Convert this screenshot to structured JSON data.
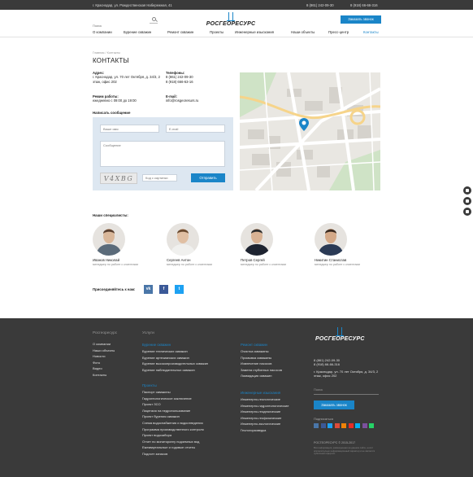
{
  "topbar": {
    "address": "г. Краснодар, ул. Рождественская Набережная, 41",
    "phone1": "8 (861) 242-09-30",
    "phone2": "8 (918) 66-66-316"
  },
  "header": {
    "search_placeholder": "Поиск",
    "logo_text": "РОСГЕОРЕСУРС",
    "call_button": "Заказать звонок"
  },
  "nav": [
    {
      "label": "О компании"
    },
    {
      "label": "Бурение скважин"
    },
    {
      "label": "Ремонт скважин"
    },
    {
      "label": "Проекты"
    },
    {
      "label": "Инженерные изыскания"
    },
    {
      "label": "Наши объекты"
    },
    {
      "label": "Пресс-центр"
    },
    {
      "label": "Контакты",
      "active": true
    }
  ],
  "breadcrumb": "Главная  /  Контакты",
  "page_title": "КОНТАКТЫ",
  "contacts": {
    "address_label": "Адрес:",
    "address_value": "г. Краснодар, ул. 70 лет Октября, д. 34/3, 2 этаж, офис 202",
    "phones_label": "Телефоны:",
    "phone1": "8 (861) 242-09-30",
    "phone2": "8 (918) 666-63-16",
    "hours_label": "Режим работы:",
    "hours_value": "ежедневно с 09:00 до 19:00",
    "email_label": "E-mail:",
    "email_value": "info@rosgeoresurs.ru"
  },
  "form": {
    "title": "Написать сообщение",
    "name_placeholder": "Ваше имя",
    "email_placeholder": "E-mail",
    "message_placeholder": "Сообщение",
    "captcha_text": "V4XBG",
    "captcha_placeholder": "Код с картинки",
    "send_button": "Отправить"
  },
  "specialists": {
    "title": "Наши специалисты:",
    "people": [
      {
        "name": "Иванов Николай",
        "position": "менеджер по работе с клиентами",
        "shirt": "#5b6b7a",
        "skin": "#d9b79a",
        "hair": "#5a4030"
      },
      {
        "name": "Сергеев Антон",
        "position": "менеджер по работе с клиентами",
        "shirt": "#f0f0ee",
        "skin": "#e0bfa3",
        "hair": "#6a4a30"
      },
      {
        "name": "Петров Сергей",
        "position": "менеджер по работе с клиентами",
        "shirt": "#1d2330",
        "skin": "#d8b294",
        "hair": "#2d2d2d"
      },
      {
        "name": "Никитин Станислав",
        "position": "менеджер по работе с клиентами",
        "shirt": "#2a3a55",
        "skin": "#d4a988",
        "hair": "#3a2a20"
      }
    ]
  },
  "join": {
    "label": "Присоединяйтесь к нам:",
    "networks": [
      {
        "icon": "vk-icon",
        "glyph": "vk",
        "color": "#4a76a8"
      },
      {
        "icon": "facebook-icon",
        "glyph": "f",
        "color": "#3b5998"
      },
      {
        "icon": "twitter-icon",
        "glyph": "t",
        "color": "#1da1f2"
      }
    ]
  },
  "footer": {
    "company_heading": "Росгеоресурс",
    "services_heading": "Услуги",
    "company_links": [
      "О компании",
      "Наши объекты",
      "Новости",
      "Фото",
      "Видео",
      "Контакты"
    ],
    "drilling": {
      "title": "Бурение скважин",
      "items": [
        "Бурение технических скважин",
        "Бурение артезианских скважин",
        "Бурение высокопроизводительных скважин",
        "Бурение наблюдательных скважин"
      ]
    },
    "repair": {
      "title": "Ремонт скважин",
      "items": [
        "Очистка скважины",
        "Промывка скважины",
        "Извлечение насосов",
        "Замена глубинных насосов",
        "Ликвидация скважин"
      ]
    },
    "projects": {
      "title": "Проекты",
      "items": [
        "Паспорт скважины",
        "Гидрогеологическое заключение",
        "Проект ЗСО",
        "Лицензия на недропользование",
        "Проект бурения скважин",
        "Схема водоснабжения и водоотведения",
        "Программа производственного контроля",
        "Проект водозабора",
        "Отчет по мониторингу подземных вод",
        "Ежеквартальные и годовые отчеты",
        "Подсчет запасов"
      ]
    },
    "surveys": {
      "title": "Инженерные изыскания",
      "items": [
        "Инженерно-геологические",
        "Инженерно-гидрогеологические",
        "Инженерно-геодезические",
        "Инженерно-геофизические",
        "Инженерно-экологические",
        "Геологоразведка"
      ]
    },
    "logo_text": "РОСГЕОРЕСУРС",
    "phone1": "8 (861) 242-09-30",
    "phone2": "8 (918) 66-66-316",
    "address": "г. Краснодар, ул. 70 лет Октября, д. 34/3, 2 этаж, офис 202",
    "search_placeholder": "Поиск",
    "call_button": "Заказать звонок",
    "social_label": "Подписаться",
    "social_icons": [
      {
        "icon": "vk-icon",
        "color": "#4a76a8"
      },
      {
        "icon": "facebook-icon",
        "color": "#3b5998"
      },
      {
        "icon": "twitter-icon",
        "color": "#1da1f2"
      },
      {
        "icon": "google-plus-icon",
        "color": "#dd4b39"
      },
      {
        "icon": "odnoklassniki-icon",
        "color": "#ee8208"
      },
      {
        "icon": "youtube-icon",
        "color": "#e52d27"
      },
      {
        "icon": "skype-icon",
        "color": "#00aff0"
      },
      {
        "icon": "viber-icon",
        "color": "#7b519d"
      },
      {
        "icon": "whatsapp-icon",
        "color": "#25d366"
      }
    ],
    "copyright": "РОСГЕОРЕСУРС © 2015-2017",
    "note": "Вся информация, размещенная на данном сайте, носит исключительно информационный характер и не является публичной офертой."
  },
  "colors": {
    "accent": "#1a85c8",
    "dark": "#3a3a3a"
  }
}
